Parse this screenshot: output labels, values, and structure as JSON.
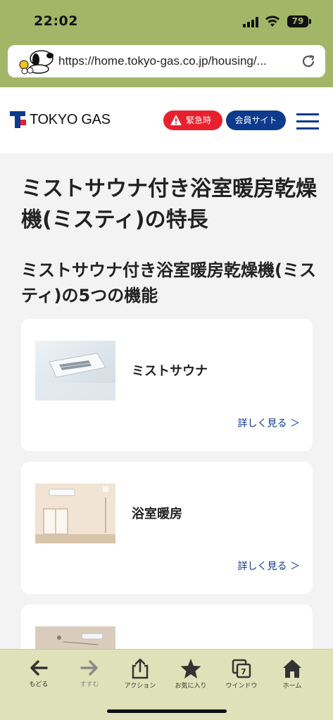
{
  "status": {
    "time": "22:02",
    "battery": "79"
  },
  "browser": {
    "url": "https://home.tokyo-gas.co.jp/housing/..."
  },
  "header": {
    "logo_text": "TOKYO GAS",
    "emergency_label": "緊急時",
    "member_label": "会員サイト"
  },
  "main": {
    "page_title": "ミストサウナ付き浴室暖房乾燥機(ミスティ)の特長",
    "section_title": "ミストサウナ付き浴室暖房乾燥機(ミスティ)の5つの機能",
    "cards": [
      {
        "title": "ミストサウナ",
        "link": "詳しく見る ＞"
      },
      {
        "title": "浴室暖房",
        "link": "詳しく見る ＞"
      },
      {
        "title": "",
        "link": ""
      }
    ]
  },
  "toolbar": {
    "items": [
      {
        "label": "もどる",
        "icon": "back-arrow-icon"
      },
      {
        "label": "すすむ",
        "icon": "forward-arrow-icon"
      },
      {
        "label": "アクション",
        "icon": "share-icon"
      },
      {
        "label": "お気に入り",
        "icon": "star-icon"
      },
      {
        "label": "ウインドウ",
        "icon": "windows-icon",
        "count": "7"
      },
      {
        "label": "ホーム",
        "icon": "home-icon"
      }
    ]
  },
  "colors": {
    "brand_blue": "#0d3a8c",
    "emergency_red": "#e8202e",
    "chrome_green": "#a3b668"
  }
}
